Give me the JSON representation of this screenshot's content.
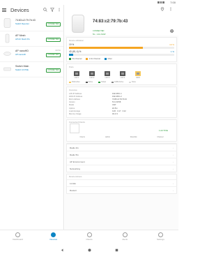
{
  "status": {
    "time": "7:00"
  },
  "left": {
    "title": "Devices",
    "devices": [
      {
        "name": "74:83:c2:79:7b:43",
        "sub": "Switch Reporter",
        "badge": "CONNECTED"
      },
      {
        "name": "AP Mesh",
        "sub": "AP AC Mesh Pro",
        "badge": "CONNECTED",
        "right": ""
      },
      {
        "name": "AP nanoHD",
        "sub": "AP nanoHD",
        "badge": "CONNECTED",
        "right": "2H 5m"
      },
      {
        "name": "Switch Main",
        "sub": "Switch 16 POE",
        "badge": "CONNECTED",
        "right": ""
      }
    ]
  },
  "detail": {
    "mac": "74:83:c2:79:7b:43",
    "line1": "CONNECTED",
    "line2": "5G · 2.4G NOW",
    "resources_title": "Device utilization",
    "cpu_label": "19 %",
    "cpu_value": "19 %",
    "mem_label": "42 (45, 4) %",
    "mem_value": "1 %",
    "legend": [
      {
        "label": "5G Channel",
        "color": "#2a9a3a"
      },
      {
        "label": "2.4G Channel",
        "color": "#f5a623"
      },
      {
        "label": "Other",
        "color": "#0a84c4"
      }
    ],
    "ports_title": "Ports",
    "ports": [
      {
        "label": "LAN 1",
        "warn": false
      },
      {
        "label": "LAN 2",
        "warn": false
      },
      {
        "label": "LAN 3",
        "warn": false
      },
      {
        "label": "LAN 4",
        "warn": false
      },
      {
        "label": "WAN",
        "warn": true
      }
    ],
    "port_legend": [
      "PoE Active",
      "Active",
      "1Gbps",
      "100M Active",
      "None"
    ],
    "overview_title": "Overview",
    "overview": [
      {
        "k": "LAN IP Address",
        "v": "192.168.1.1"
      },
      {
        "k": "WAN IP Address",
        "v": "192.168.1.2"
      },
      {
        "k": "MAC Address",
        "v": "74:83:c2:79:7b:43"
      },
      {
        "k": "Version",
        "v": "5.6.4.9708"
      },
      {
        "k": "Model",
        "v": "UAP"
      },
      {
        "k": "Uptime",
        "v": "2H 5m"
      },
      {
        "k": "Load Average",
        "v": "0.20 · 0.17 · 0.12"
      },
      {
        "k": "Memory Usage",
        "v": "40 of 4"
      }
    ],
    "client_title": "Connected Clients",
    "client_value": "1 ACTIVE",
    "client_stats": [
      "Clients",
      "Uplink",
      "Downlink",
      "Channel"
    ],
    "rows": [
      "Radio 2G",
      "Radio 5G",
      "AP Environment",
      "Networking"
    ],
    "section2_title": "Device Actions",
    "rows2": [
      "Locate",
      "Restart"
    ]
  },
  "tabs": [
    {
      "label": "Dashboard",
      "active": false
    },
    {
      "label": "Devices",
      "active": true
    },
    {
      "label": "Clients",
      "active": false
    },
    {
      "label": "Alerts",
      "active": false
    },
    {
      "label": "Settings",
      "active": false
    }
  ]
}
